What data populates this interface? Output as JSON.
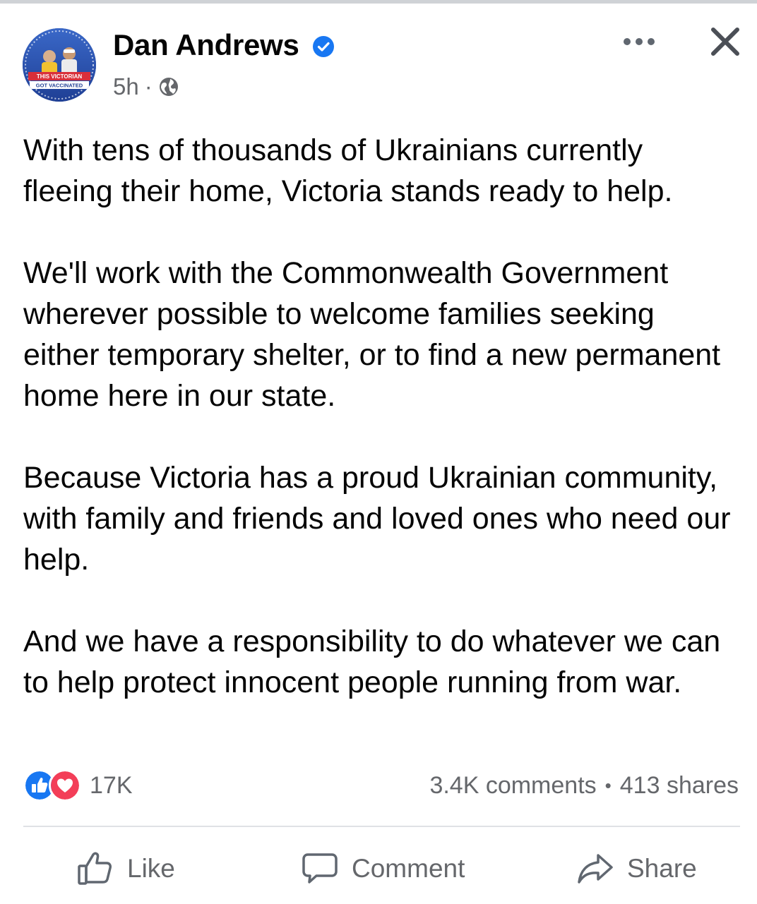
{
  "post": {
    "author": "Dan Andrews",
    "verified": true,
    "timestamp": "5h",
    "meta_separator": "·",
    "audience_icon": "globe-icon",
    "avatar_text_top": "THIS VICTORIAN",
    "avatar_text_bottom": "GOT VACCINATED",
    "paragraphs": [
      "With tens of thousands of Ukrainians currently fleeing their home, Victoria stands ready to help.",
      "We'll work with the Commonwealth Government wherever possible to welcome families seeking either temporary shelter, or to find a new permanent home here in our state.",
      "Because Victoria has a proud Ukrainian community, with family and friends and loved ones who need our help.",
      "And we have a responsibility to do whatever we can to help protect innocent people running from war."
    ]
  },
  "stats": {
    "reactions": "17K",
    "comments": "3.4K comments",
    "separator": "•",
    "shares": "413 shares"
  },
  "actions": {
    "like": "Like",
    "comment": "Comment",
    "share": "Share"
  },
  "colors": {
    "verified_blue": "#1877f2",
    "love_red": "#f33e58",
    "secondary_text": "#65676b",
    "divider": "#dfe1e5"
  }
}
